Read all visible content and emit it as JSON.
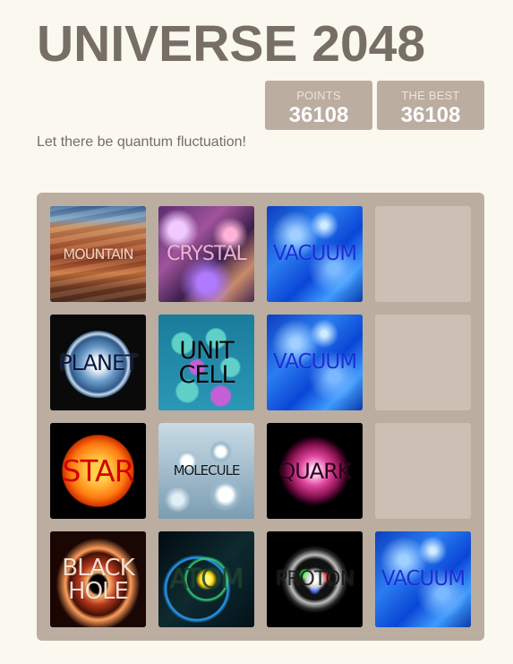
{
  "app": {
    "title": "UNIVERSE 2048",
    "intro": "Let there be quantum fluctuation!"
  },
  "scores": {
    "points_label": "POINTS",
    "points_value": "36108",
    "best_label": "THE BEST",
    "best_value": "36108"
  },
  "colors": {
    "background": "#faf8ef",
    "board": "#bbada0",
    "title": "#776e65",
    "empty_cell": "rgba(238,228,218,0.35)"
  },
  "board": {
    "rows": [
      [
        {
          "label": "MOUNTAIN",
          "art": "mountain"
        },
        {
          "label": "CRYSTAL",
          "art": "crystal"
        },
        {
          "label": "VACUUM",
          "art": "vacuum"
        },
        {
          "label": "",
          "art": "empty"
        }
      ],
      [
        {
          "label": "PLANET",
          "art": "planet"
        },
        {
          "label": "UNIT\nCELL",
          "art": "cell"
        },
        {
          "label": "VACUUM",
          "art": "vacuum"
        },
        {
          "label": "",
          "art": "empty"
        }
      ],
      [
        {
          "label": "STAR",
          "art": "star"
        },
        {
          "label": "MOLECULE",
          "art": "molecule"
        },
        {
          "label": "QUARK",
          "art": "quark"
        },
        {
          "label": "",
          "art": "empty"
        }
      ],
      [
        {
          "label": "BLACK\nHOLE",
          "art": "blackhole"
        },
        {
          "label": "ATOM",
          "art": "atom"
        },
        {
          "label": "PROTON",
          "art": "proton"
        },
        {
          "label": "VACUUM",
          "art": "vacuum"
        }
      ]
    ]
  }
}
